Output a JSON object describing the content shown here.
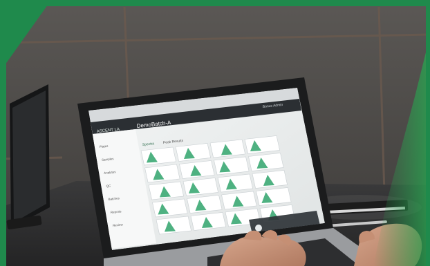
{
  "photo": {
    "subject": "person-using-laptop",
    "colors": {
      "frame_green": "#1f8a4c",
      "wall": "#4e4b48",
      "desk": "#2f2f30",
      "chart_fill": "#2fa36b",
      "screen_bg": "#eef0f0",
      "app_header": "#2b2f33"
    }
  },
  "laptop_screen": {
    "brand": "ASCENT LA",
    "app_title": "DemoBatch-A",
    "user_label": "Bonus Admin",
    "tabs": [
      {
        "label": "Spectra"
      },
      {
        "label": "Peak Results"
      }
    ],
    "sidebar_items": [
      {
        "label": "Plates"
      },
      {
        "label": "Samples"
      },
      {
        "label": "Analytes"
      },
      {
        "label": "QC"
      },
      {
        "label": "Batches"
      },
      {
        "label": "Reports"
      },
      {
        "label": "Review"
      }
    ]
  }
}
